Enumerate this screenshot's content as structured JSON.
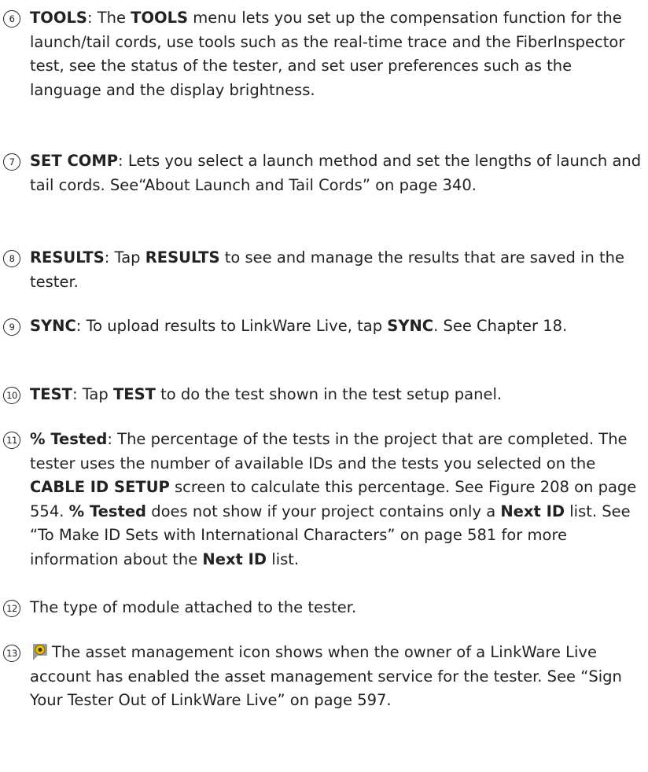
{
  "items": [
    {
      "number": "6",
      "parts": [
        {
          "t": "TOOLS",
          "b": true
        },
        {
          "t": ": The ",
          "b": false
        },
        {
          "t": "TOOLS",
          "b": true
        },
        {
          "t": " menu lets you set up the compensation function for the launch/tail cords, use tools such as the real-time trace and the FiberInspector test, see the status of the tester, and set user preferences such as the language and the display brightness.",
          "b": false
        }
      ]
    },
    {
      "number": "7",
      "parts": [
        {
          "t": "SET COMP",
          "b": true
        },
        {
          "t": ": Lets you select a launch method and set the lengths of launch and tail cords. See“About Launch and Tail Cords” on page 340.",
          "b": false
        }
      ]
    },
    {
      "number": "8",
      "parts": [
        {
          "t": "RESULTS",
          "b": true
        },
        {
          "t": ": Tap ",
          "b": false
        },
        {
          "t": "RESULTS",
          "b": true
        },
        {
          "t": " to see and manage the results that are saved in the tester.",
          "b": false
        }
      ]
    },
    {
      "number": "9",
      "parts": [
        {
          "t": "SYNC",
          "b": true
        },
        {
          "t": ": To upload results to LinkWare Live, tap ",
          "b": false
        },
        {
          "t": "SYNC",
          "b": true
        },
        {
          "t": ". See Chapter 18.",
          "b": false
        }
      ]
    },
    {
      "number": "10",
      "parts": [
        {
          "t": "TEST",
          "b": true
        },
        {
          "t": ": Tap ",
          "b": false
        },
        {
          "t": "TEST",
          "b": true
        },
        {
          "t": " to do the test shown in the test setup panel.",
          "b": false
        }
      ]
    },
    {
      "number": "11",
      "parts": [
        {
          "t": "% Tested",
          "b": true
        },
        {
          "t": ": The percentage of the tests in the project that are completed. The tester uses the number of available IDs and the tests you selected on the ",
          "b": false
        },
        {
          "t": "CABLE ID SETUP",
          "b": true
        },
        {
          "t": " screen to calculate this percentage. See Figure 208 on page 554. ",
          "b": false
        },
        {
          "t": "% Tested",
          "b": true
        },
        {
          "t": " does not show if your project contains only a ",
          "b": false
        },
        {
          "t": "Next ID",
          "b": true
        },
        {
          "t": " list. See “To Make ID Sets with International Characters” on page 581 for more information about the ",
          "b": false
        },
        {
          "t": "Next ID",
          "b": true
        },
        {
          "t": " list.",
          "b": false
        }
      ]
    },
    {
      "number": "12",
      "parts": [
        {
          "t": "The type of module attached to the tester.",
          "b": false
        }
      ]
    },
    {
      "number": "13",
      "icon": "asset-management-icon",
      "parts": [
        {
          "t": "The asset management icon shows when the owner of a LinkWare Live account has enabled the asset management service for the tester. See “Sign Your Tester Out of LinkWare Live” on page 597.",
          "b": false
        }
      ]
    }
  ]
}
